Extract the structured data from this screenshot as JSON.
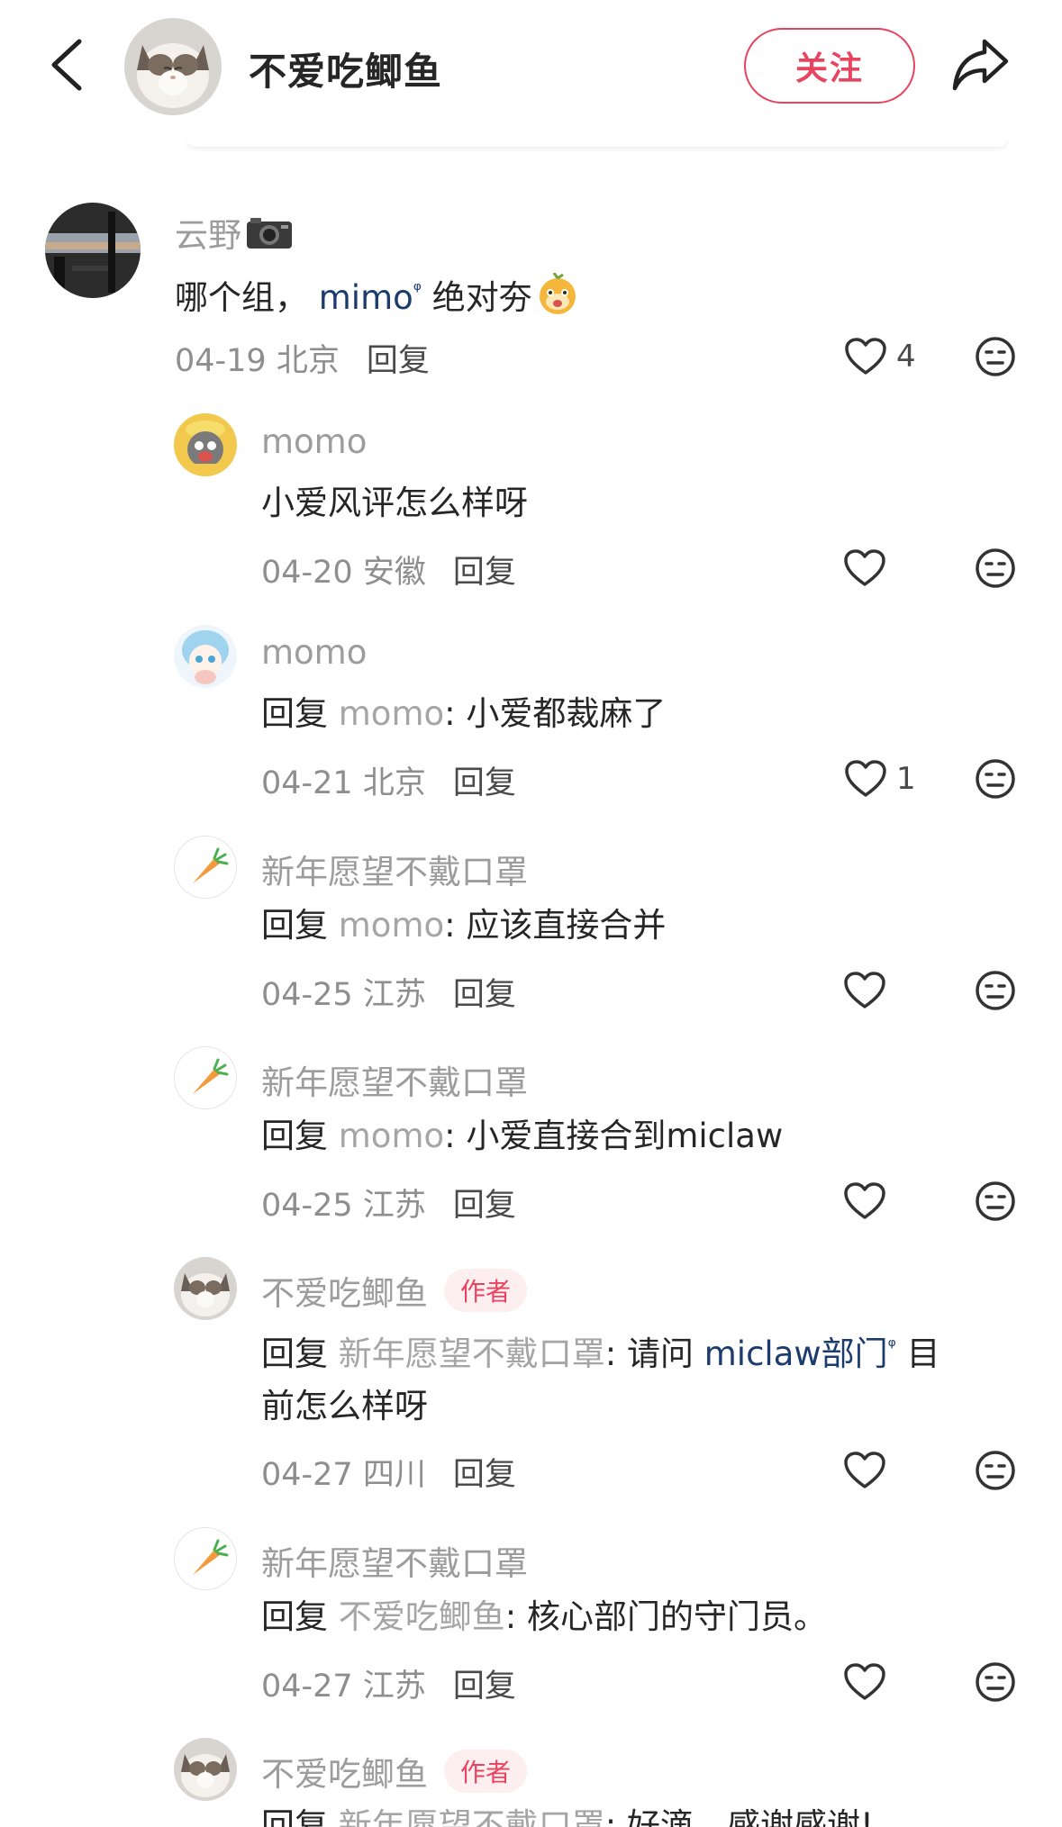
{
  "header": {
    "username": "不爱吃鲫鱼",
    "follow_label": "关注"
  },
  "comments": [
    {
      "name": "云野",
      "text_plain": "哪个组，",
      "link": "mimo",
      "text_after": "绝对夯",
      "date": "04-19",
      "location": "北京",
      "reply_label": "回复",
      "likes": "4"
    },
    {
      "name": "momo",
      "text": "小爱风评怎么样呀",
      "date": "04-20",
      "location": "安徽",
      "reply_label": "回复",
      "likes": ""
    },
    {
      "name": "momo",
      "reply_prefix": "回复",
      "reply_to": "momo",
      "text": "小爱都裁麻了",
      "date": "04-21",
      "location": "北京",
      "reply_label": "回复",
      "likes": "1"
    },
    {
      "name": "新年愿望不戴口罩",
      "reply_prefix": "回复",
      "reply_to": "momo",
      "text": "应该直接合并",
      "date": "04-25",
      "location": "江苏",
      "reply_label": "回复",
      "likes": ""
    },
    {
      "name": "新年愿望不戴口罩",
      "reply_prefix": "回复",
      "reply_to": "momo",
      "text": "小爱直接合到miclaw",
      "date": "04-25",
      "location": "江苏",
      "reply_label": "回复",
      "likes": ""
    },
    {
      "name": "不爱吃鲫鱼",
      "badge": "作者",
      "reply_prefix": "回复",
      "reply_to": "新年愿望不戴口罩",
      "text_before": "请问",
      "link": "miclaw部门",
      "text_after": "目",
      "text_line2": "前怎么样呀",
      "date": "04-27",
      "location": "四川",
      "reply_label": "回复",
      "likes": ""
    },
    {
      "name": "新年愿望不戴口罩",
      "reply_prefix": "回复",
      "reply_to": "不爱吃鲫鱼",
      "text": "核心部门的守门员。",
      "date": "04-27",
      "location": "江苏",
      "reply_label": "回复",
      "likes": ""
    },
    {
      "name": "不爱吃鲫鱼",
      "badge": "作者",
      "reply_prefix": "回复",
      "reply_to": "新年愿望不戴口罩",
      "text": "好滴，感谢感谢!"
    }
  ],
  "icons": {
    "back": "chevron-left-icon",
    "share": "share-arrow-icon",
    "like": "heart-outline-icon",
    "emoji": "emoji-face-icon",
    "camera": "camera-emoji",
    "carrot": "carrot-avatar"
  },
  "colors": {
    "accent": "#e8435f",
    "link": "#1d3c6e",
    "muted": "#9c9c9c"
  }
}
